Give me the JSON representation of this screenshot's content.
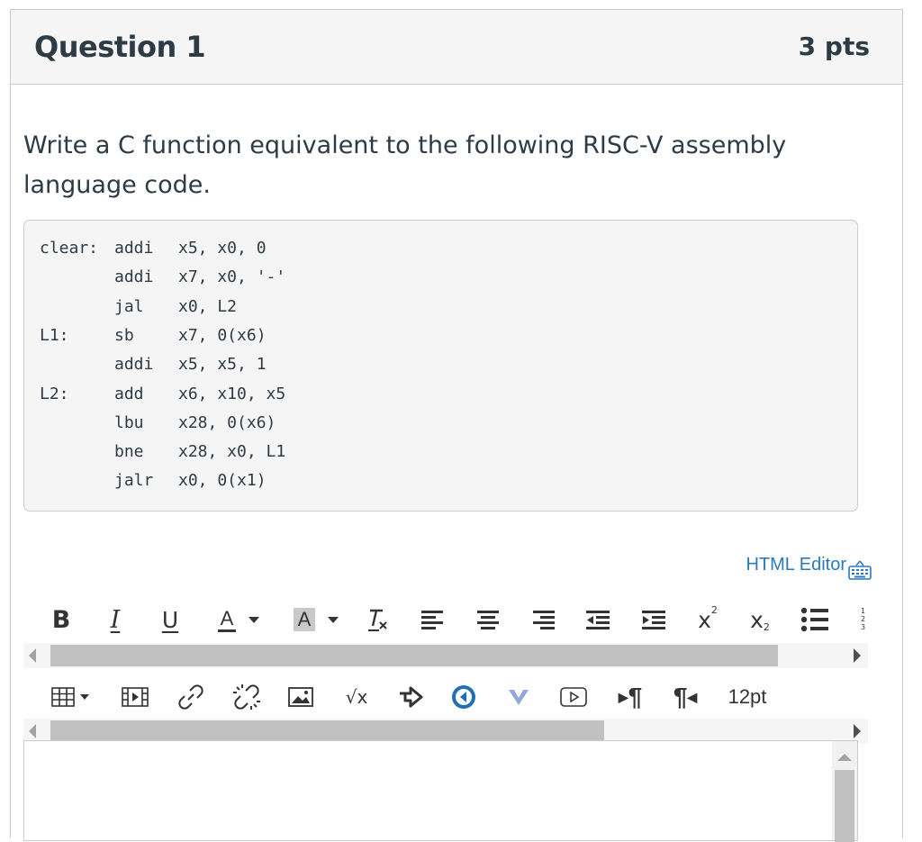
{
  "question": {
    "title": "Question 1",
    "points": "3 pts",
    "text": "Write a C function equivalent to the following RISC-V assembly language code."
  },
  "code": [
    {
      "label": "clear:",
      "op": "addi",
      "args": "x5, x0, 0"
    },
    {
      "label": "",
      "op": "addi",
      "args": "x7, x0, '-'"
    },
    {
      "label": "",
      "op": "jal",
      "args": "x0, L2"
    },
    {
      "label": "L1:",
      "op": "sb",
      "args": "x7, 0(x6)"
    },
    {
      "label": "",
      "op": "addi",
      "args": "x5, x5, 1"
    },
    {
      "label": "L2:",
      "op": "add",
      "args": "x6, x10, x5"
    },
    {
      "label": "",
      "op": "lbu",
      "args": "x28, 0(x6)"
    },
    {
      "label": "",
      "op": "bne",
      "args": "x28, x0, L1"
    },
    {
      "label": "",
      "op": "jalr",
      "args": "x0, 0(x1)"
    }
  ],
  "editor": {
    "html_editor_link": "HTML Editor",
    "toolbar1": {
      "bold": "B",
      "italic": "I",
      "underline": "U",
      "font_color": "A",
      "background_color": "A",
      "superscript": "x",
      "subscript": "x"
    },
    "toolbar2": {
      "font_size": "12pt"
    },
    "scrollbar1_position": 0.92,
    "scrollbar2_position": 0.7
  },
  "colors": {
    "link": "#2b7abc",
    "header_bg": "#f5f5f5",
    "border": "#c7cdd1"
  }
}
